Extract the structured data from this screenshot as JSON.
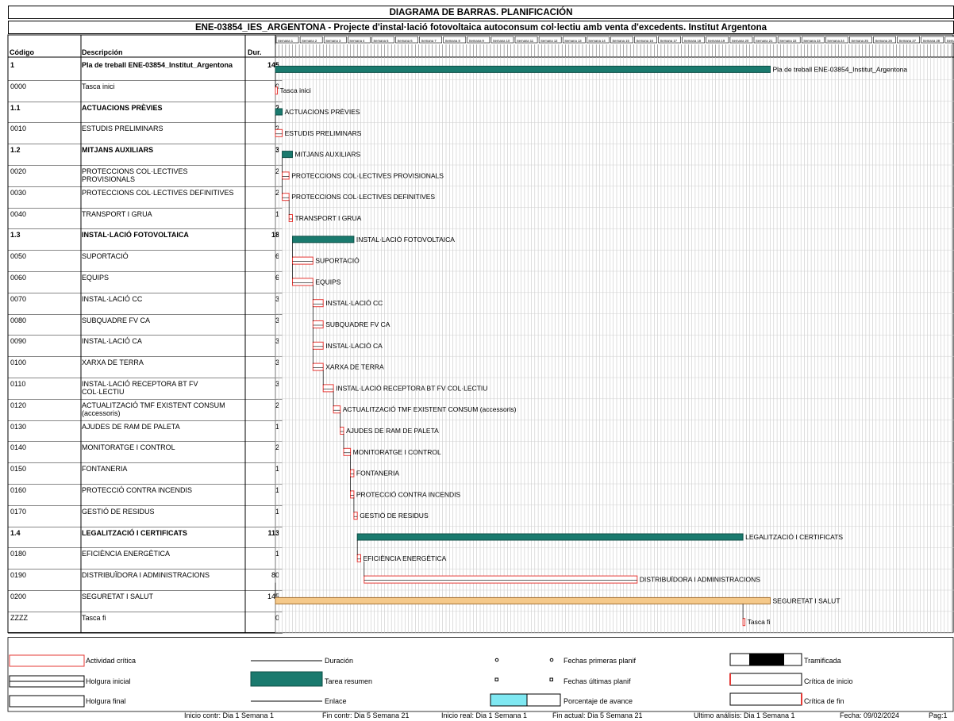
{
  "title": "DIAGRAMA DE BARRAS. PLANIFICACIÓN",
  "subtitle": "ENE-03854_IES_ARGENTONA - Projecte d'instal·lació fotovoltaica autoconsum col·lectiu amb venta d'excedents. Institut Argentona",
  "columns": {
    "code": "Código",
    "desc": "Descripción",
    "dur": "Dur."
  },
  "timeline": {
    "units": [
      "Semana 1",
      "Semana 2",
      "Semana 3",
      "Semana 4",
      "Semana 5",
      "Semana 6",
      "Semana 7",
      "Semana 8",
      "Semana 9",
      "Semana 10",
      "Semana 11",
      "Semana 12",
      "Semana 13",
      "Semana 14",
      "Semana 15",
      "Semana 16",
      "Semana 17",
      "Semana 18",
      "Semana 19",
      "Semana 20",
      "Semana 21",
      "Semana 22",
      "Semana 23",
      "Semana 24",
      "Semana 25",
      "Semana 26",
      "Semana 27",
      "Semana 28",
      "Semana 29",
      "Semana 30"
    ],
    "days_per_unit": 7
  },
  "chart_data": {
    "type": "gantt",
    "x_unit": "days",
    "tasks": [
      {
        "code": "1",
        "desc": "Pla de treball ENE-03854_Institut_Argentona",
        "dur": 145,
        "start": 0,
        "kind": "summary",
        "bold": true
      },
      {
        "code": "0000",
        "desc": "Tasca inici",
        "dur": 0,
        "start": 0,
        "kind": "critical"
      },
      {
        "code": "1.1",
        "desc": "ACTUACIONS PRÈVIES",
        "dur": 2,
        "start": 0,
        "kind": "summary",
        "bold": true
      },
      {
        "code": "0010",
        "desc": "ESTUDIS PRELIMINARS",
        "dur": 2,
        "start": 0,
        "kind": "critical"
      },
      {
        "code": "1.2",
        "desc": "MITJANS AUXILIARS",
        "dur": 3,
        "start": 2,
        "kind": "summary",
        "bold": true
      },
      {
        "code": "0020",
        "desc": "PROTECCIONS COL·LECTIVES PROVISIONALS",
        "dur": 2,
        "start": 2,
        "kind": "critical"
      },
      {
        "code": "0030",
        "desc": "PROTECCIONS COL·LECTIVES DEFINITIVES",
        "dur": 2,
        "start": 2,
        "kind": "critical"
      },
      {
        "code": "0040",
        "desc": "TRANSPORT I GRUA",
        "dur": 1,
        "start": 4,
        "kind": "critical"
      },
      {
        "code": "1.3",
        "desc": "INSTAL·LACIÓ FOTOVOLTAICA",
        "dur": 18,
        "start": 5,
        "kind": "summary",
        "bold": true
      },
      {
        "code": "0050",
        "desc": "SUPORTACIÓ",
        "dur": 6,
        "start": 5,
        "kind": "critical"
      },
      {
        "code": "0060",
        "desc": "EQUIPS",
        "dur": 6,
        "start": 5,
        "kind": "critical"
      },
      {
        "code": "0070",
        "desc": "INSTAL·LACIÓ CC",
        "dur": 3,
        "start": 11,
        "kind": "critical"
      },
      {
        "code": "0080",
        "desc": "SUBQUADRE FV CA",
        "dur": 3,
        "start": 11,
        "kind": "critical"
      },
      {
        "code": "0090",
        "desc": "INSTAL·LACIÓ CA",
        "dur": 3,
        "start": 11,
        "kind": "critical"
      },
      {
        "code": "0100",
        "desc": "XARXA DE TERRA",
        "dur": 3,
        "start": 11,
        "kind": "critical"
      },
      {
        "code": "0110",
        "desc": "INSTAL·LACIÓ RECEPTORA BT FV COL·LECTIU",
        "dur": 3,
        "start": 14,
        "kind": "critical"
      },
      {
        "code": "0120",
        "desc": "ACTUALITZACIÓ TMF EXISTENT CONSUM (accessoris)",
        "dur": 2,
        "start": 17,
        "kind": "critical"
      },
      {
        "code": "0130",
        "desc": "AJUDES DE RAM DE PALETA",
        "dur": 1,
        "start": 19,
        "kind": "critical"
      },
      {
        "code": "0140",
        "desc": "MONITORATGE I CONTROL",
        "dur": 2,
        "start": 20,
        "kind": "critical"
      },
      {
        "code": "0150",
        "desc": "FONTANERIA",
        "dur": 1,
        "start": 22,
        "kind": "critical"
      },
      {
        "code": "0160",
        "desc": "PROTECCIÓ CONTRA INCENDIS",
        "dur": 1,
        "start": 22,
        "kind": "critical"
      },
      {
        "code": "0170",
        "desc": "GESTIÓ DE RESIDUS",
        "dur": 1,
        "start": 23,
        "kind": "critical"
      },
      {
        "code": "1.4",
        "desc": "LEGALITZACIÓ I CERTIFICATS",
        "dur": 113,
        "start": 24,
        "kind": "summary",
        "bold": true
      },
      {
        "code": "0180",
        "desc": "EFICIÈNCIA ENERGÈTICA",
        "dur": 1,
        "start": 24,
        "kind": "critical"
      },
      {
        "code": "0190",
        "desc": "DISTRIBUÏDORA I ADMINISTRACIONS",
        "dur": 80,
        "start": 26,
        "kind": "critical"
      },
      {
        "code": "0200",
        "desc": "SEGURETAT I SALUT",
        "dur": 145,
        "start": 0,
        "kind": "normal"
      },
      {
        "code": "ZZZZ",
        "desc": "Tasca fi",
        "dur": 0,
        "start": 137,
        "kind": "critical"
      }
    ]
  },
  "legend": {
    "critical": "Actividad crítica",
    "slack_start": "Holgura inicial",
    "slack_end": "Holgura final",
    "duration": "Duración",
    "summary": "Tarea resumen",
    "link": "Enlace",
    "early": "Fechas primeras planif",
    "late": "Fechas últimas planif",
    "progress": "Porcentaje de avance",
    "split": "Tramificada",
    "crit_start": "Crítica de inicio",
    "crit_end": "Crítica de fin"
  },
  "footer": {
    "inicio_contr": "Inicio contr: Dia 1 Semana 1",
    "fin_contr": "Fin contr: Dia 5 Semana 21",
    "inicio_real": "Inicio real: Dia 1 Semana 1",
    "fin_actual": "Fin actual: Dia 5 Semana 21",
    "ultimo": "Ultimo análisis: Dia 1 Semana 1",
    "fecha": "Fecha: 09/02/2024",
    "pag": "Pag:1"
  },
  "colors": {
    "summary": "#1a7a6e",
    "critical": "#e53935",
    "normal": "#f5c98a",
    "grid": "#c8c8c8",
    "progress": "#7fe8f2"
  }
}
